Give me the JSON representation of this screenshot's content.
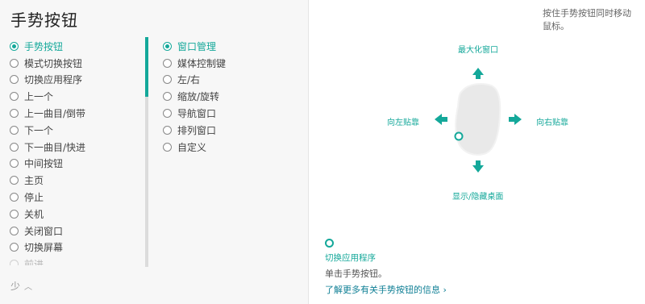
{
  "page": {
    "title": "手势按钮",
    "collapse_label": "少",
    "collapse_icon": "chevron-up-icon"
  },
  "button_list": [
    {
      "label": "手势按钮",
      "selected": true
    },
    {
      "label": "模式切换按钮"
    },
    {
      "label": "切换应用程序"
    },
    {
      "label": "上一个"
    },
    {
      "label": "上一曲目/倒带"
    },
    {
      "label": "下一个"
    },
    {
      "label": "下一曲目/快进"
    },
    {
      "label": "中间按钮"
    },
    {
      "label": "主页"
    },
    {
      "label": "停止"
    },
    {
      "label": "关机"
    },
    {
      "label": "关闭窗口"
    },
    {
      "label": "切换屏幕"
    },
    {
      "label": "前进",
      "faded": true
    }
  ],
  "gesture_options": [
    {
      "label": "窗口管理",
      "selected": true
    },
    {
      "label": "媒体控制键"
    },
    {
      "label": "左/右"
    },
    {
      "label": "缩放/旋转"
    },
    {
      "label": "导航窗口"
    },
    {
      "label": "排列窗口"
    },
    {
      "label": "自定义"
    }
  ],
  "instruction": "按住手势按钮同时移动鼠标。",
  "diagram": {
    "up": "最大化窗口",
    "left": "向左贴靠",
    "right": "向右贴靠",
    "down": "显示/隐藏桌面"
  },
  "bottom": {
    "button_name": "切换应用程序",
    "description": "单击手势按钮。",
    "link": "了解更多有关手势按钮的信息 ›"
  },
  "colors": {
    "accent": "#14a89a",
    "panel_bg": "#f7f7f7"
  }
}
